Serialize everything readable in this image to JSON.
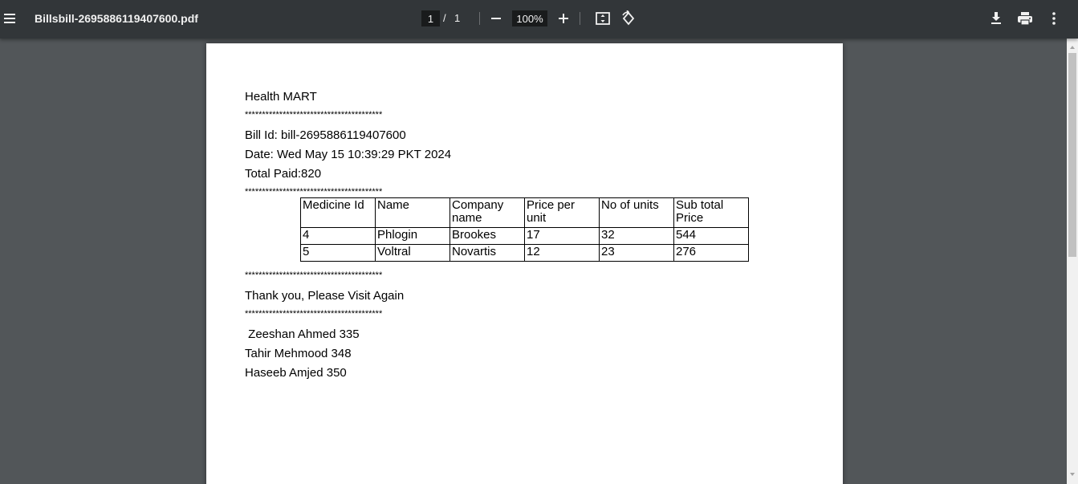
{
  "toolbar": {
    "menu_icon": "hamburger-menu-icon",
    "title": "Billsbill-2695886119407600.pdf",
    "page_current": "1",
    "page_separator": "/",
    "page_total": "1",
    "zoom": "100%",
    "icons": [
      "zoom-out-icon",
      "zoom-in-icon",
      "fit-to-page-icon",
      "rotate-icon",
      "download-icon",
      "print-icon",
      "more-options-icon"
    ]
  },
  "document": {
    "store_name": "Health MART",
    "separator": "****************************************",
    "bill_id": "Bill Id: bill-2695886119407600",
    "date": "Date: Wed May 15 10:39:29 PKT 2024",
    "total_paid": "Total Paid:820",
    "table": {
      "headers": [
        "Medicine Id",
        "Name",
        "Company name",
        "Price per unit",
        "No of units",
        "Sub total Price"
      ],
      "rows": [
        [
          "4",
          "Phlogin",
          "Brookes",
          "17",
          "32",
          "544"
        ],
        [
          "5",
          "Voltral",
          "Novartis",
          "12",
          "23",
          "276"
        ]
      ]
    },
    "thanks": "Thank you, Please Visit Again",
    "credits": [
      " Zeeshan Ahmed 335",
      "Tahir Mehmood 348",
      "Haseeb Amjed 350"
    ]
  },
  "colors": {
    "toolbar_bg": "#323639",
    "viewer_bg": "#525659",
    "page_bg": "#ffffff"
  }
}
